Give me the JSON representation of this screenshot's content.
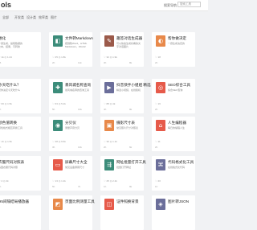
{
  "header": {
    "brand": "ols",
    "search_label": "搜索导航",
    "search_placeholder": "搜索工具"
  },
  "subnav": [
    "全部",
    "开发类",
    "设计类",
    "效率类",
    "图片",
    "在线",
    "便民"
  ],
  "cards": [
    {
      "title": "进化",
      "desc": "一键生成，提取数据的文本，结果，可转换",
      "meta": "♡ 1k  ◎ 1.24",
      "meta2": "45",
      "meta3": "",
      "color": "#ffffff",
      "glyph": ""
    },
    {
      "title": "文件转Markdown",
      "desc": "把微软Word，HTML Markdown，Word2",
      "meta": "♡ 25  ◎ 1.8k",
      "meta2": "2h",
      "meta3": "11k",
      "color": "#3c8c7a",
      "glyph": "◧"
    },
    {
      "title": "趣签对话生成器",
      "desc": "可以快速生成好看的文字对话图片",
      "meta": "♡ 32  ◎ 1.9k",
      "meta2": "3h",
      "meta3": "8k",
      "color": "#9b5a4a",
      "glyph": "✎"
    },
    {
      "title": "帮你做决定",
      "desc": "一键生成决定的",
      "meta": "♡ 18",
      "meta2": "2h",
      "meta3": "",
      "color": "#e8894a",
      "glyph": "◐"
    },
    {
      "title": "今天吃什么？",
      "desc": "帮你决定今天吃什么",
      "meta": "♡ 60  ◎ 1.5k",
      "meta2": "9h",
      "meta3": "",
      "color": "#ffffff",
      "glyph": ""
    },
    {
      "title": "暴风城名称查询",
      "desc": "暴风城名称的查询工具",
      "meta": "♡ 63  ◎ 5.2k",
      "meta2": "5h",
      "meta3": "13k",
      "color": "#3c8c7a",
      "glyph": "✚"
    },
    {
      "title": "抖音快手小姐姐 精选",
      "desc": "精选小视频，在线随机",
      "meta": "♡ 88  ◎ 4k",
      "meta2": "4h",
      "meta3": "9k",
      "color": "#6b6e9a",
      "glyph": "▶"
    },
    {
      "title": "SEO综合工具",
      "desc": "综合SEO查询",
      "meta": "♡ 16",
      "meta2": "2h",
      "meta3": "",
      "color": "#e65a4a",
      "glyph": "◎"
    },
    {
      "title": "颜色值转换",
      "desc": "颜色格式相互转换工具",
      "meta": "♡ 1h  ◎ 1.5k",
      "meta2": "3h",
      "meta3": "",
      "color": "#ffffff",
      "glyph": ""
    },
    {
      "title": "分贝仪",
      "desc": "测量声音分贝",
      "meta": "♡ 48  ◎ 9.6k",
      "meta2": "3h",
      "meta3": "13k",
      "color": "#3c8c7a",
      "glyph": "◉"
    },
    {
      "title": "摄影尺寸表",
      "desc": "常见照片尺寸对照表",
      "meta": "♡ 30  ◎ 1.1k",
      "meta2": "2h",
      "meta3": "6k",
      "color": "#e8894a",
      "glyph": "▣"
    },
    {
      "title": "人生编程器",
      "desc": "每日的编程人生",
      "meta": "♡ 11",
      "meta2": "2h",
      "meta3": "",
      "color": "#e65a4a",
      "glyph": "⌂"
    },
    {
      "title": "衣服尺码对照表",
      "desc": "各国衣服尺码对照",
      "meta": "♡ 4  ◎ 2k",
      "meta2": "2h",
      "meta3": "",
      "color": "#ffffff",
      "glyph": ""
    },
    {
      "title": "屏幕尺寸大全",
      "desc": "常见设备屏幕尺寸",
      "meta": "♡ 13  ◎ 1.2k",
      "meta2": "5h",
      "meta3": "7k",
      "color": "#e65a4a",
      "glyph": "▭"
    },
    {
      "title": "网址批量打开工具",
      "desc": "批量打开网址",
      "meta": "♡ 25  ◎ 2.2k",
      "meta2": "1h",
      "meta3": "9k",
      "color": "#3c8c7a",
      "glyph": "⇶"
    },
    {
      "title": "代码格式化工具",
      "desc": "在线格式化代码",
      "meta": "♡ 20",
      "meta2": "1h",
      "meta3": "",
      "color": "#6b6e9a",
      "glyph": "⌘"
    },
    {
      "title": "H5间隔结局播放器",
      "desc": "",
      "meta": "",
      "meta2": "",
      "meta3": "",
      "color": "#ffffff",
      "glyph": ""
    },
    {
      "title": "页面比例测量工具",
      "desc": "",
      "meta": "",
      "meta2": "",
      "meta3": "",
      "color": "#e8894a",
      "glyph": "◩"
    },
    {
      "title": "证件照换背景",
      "desc": "",
      "meta": "",
      "meta2": "",
      "meta3": "",
      "color": "#e65a4a",
      "glyph": "◫"
    },
    {
      "title": "图片转JSON",
      "desc": "",
      "meta": "",
      "meta2": "",
      "meta3": "",
      "color": "#6b6e9a",
      "glyph": "◈"
    }
  ]
}
